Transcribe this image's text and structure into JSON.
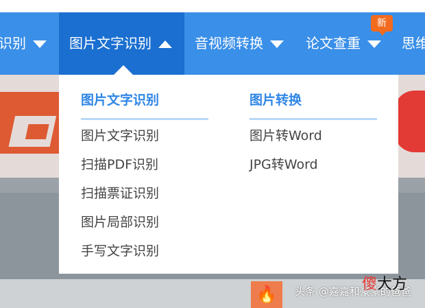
{
  "nav": {
    "items": [
      {
        "label": "识别"
      },
      {
        "label": "图片文字识别"
      },
      {
        "label": "音视频转换"
      },
      {
        "label": "论文查重"
      },
      {
        "label": "思维"
      }
    ],
    "badge": "新"
  },
  "dropdown": {
    "columns": [
      {
        "title": "图片文字识别",
        "links": [
          "图片文字识别",
          "扫描PDF识别",
          "扫描票证识别",
          "图片局部识别",
          "手写文字识别"
        ]
      },
      {
        "title": "图片转换",
        "links": [
          "图片转Word",
          "JPG转Word"
        ]
      }
    ]
  },
  "watermark": {
    "text": "头条 @嘉嘉和豪豪的爸爸",
    "logo_a": "傻",
    "logo_b": "大方"
  },
  "colors": {
    "nav_bg": "#3a8fe8",
    "nav_active_bg": "#1a6fd0",
    "column_title": "#2f86e6",
    "badge": "#f26b1f"
  },
  "icons": {
    "hot": "fire-icon",
    "caret": "triangle-icon"
  }
}
